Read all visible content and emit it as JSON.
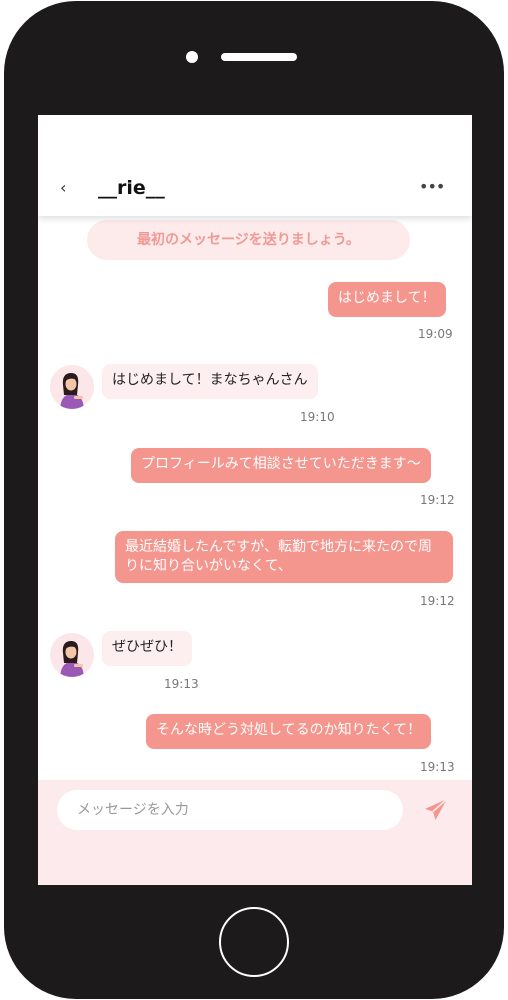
{
  "chat": {
    "title": "__rie__",
    "back_label": "‹",
    "more_label": "•••",
    "notice": "最初のメッセージを送りましょう。"
  },
  "messages": [
    {
      "side": "out",
      "text": "はじめまして！",
      "time": "19:09"
    },
    {
      "side": "in",
      "text": "はじめまして！まなちゃんさん",
      "time": "19:10"
    },
    {
      "side": "out",
      "text": "プロフィールみて相談させていただきます〜",
      "time": "19:12"
    },
    {
      "side": "out",
      "text": "最近結婚したんですが、転勤で地方に来たので周りに知り合いがいなくて、",
      "time": "19:12"
    },
    {
      "side": "in",
      "text": "ぜひぜひ！",
      "time": "19:13"
    },
    {
      "side": "out",
      "text": "そんな時どう対処してるのか知りたくて！",
      "time": "19:13"
    }
  ],
  "composer": {
    "placeholder": "メッセージを入力"
  },
  "colors": {
    "accent": "#f4958e",
    "notice_bg": "#fdeaea",
    "incoming_bg": "#fdeef0",
    "composer_bg": "#fdeaed",
    "phone_body": "#1c1a1b"
  },
  "icons": [
    "back-chevron-icon",
    "more-dots-icon",
    "avatar-woman-icon",
    "send-paper-plane-icon"
  ]
}
